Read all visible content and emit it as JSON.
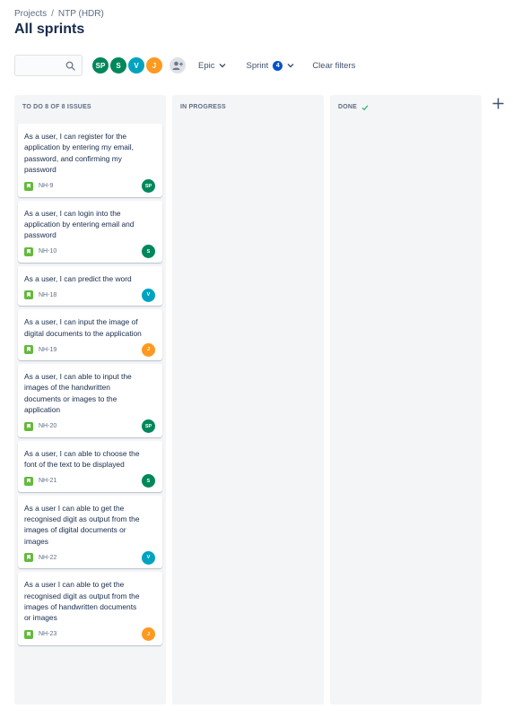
{
  "breadcrumb": {
    "root": "Projects",
    "separator": "/",
    "project": "NTP (HDR)"
  },
  "page_title": "All sprints",
  "toolbar": {
    "search_placeholder": "",
    "avatars": [
      {
        "initials": "SP",
        "color": "#00875a"
      },
      {
        "initials": "S",
        "color": "#00875a"
      },
      {
        "initials": "V",
        "color": "#00a3bf"
      },
      {
        "initials": "J",
        "color": "#ff991f"
      }
    ],
    "epic_label": "Epic",
    "sprint_label": "Sprint",
    "sprint_count": "4",
    "clear_filters_label": "Clear filters"
  },
  "columns": [
    {
      "title": "TO DO 8 OF 8 ISSUES"
    },
    {
      "title": "IN PROGRESS"
    },
    {
      "title": "DONE"
    }
  ],
  "cards": [
    {
      "title": "As a user, I can register for the application by entering my email, password, and confirming my password",
      "key": "NH-9",
      "assignee": "SP",
      "assignee_color": "#00875a"
    },
    {
      "title": "As a user, I can login into the application by entering email and password",
      "key": "NH-10",
      "assignee": "S",
      "assignee_color": "#00875a"
    },
    {
      "title": "As a user, I can predict the word",
      "key": "NH-18",
      "assignee": "V",
      "assignee_color": "#00a3bf"
    },
    {
      "title": "As a user, I can input the image of digital documents to the application",
      "key": "NH-19",
      "assignee": "J",
      "assignee_color": "#ff991f"
    },
    {
      "title": "As a user, I can able to input the images of the handwritten documents or images to the application",
      "key": "NH-20",
      "assignee": "SP",
      "assignee_color": "#00875a"
    },
    {
      "title": "As a user, I can able to choose the font of the text to be displayed",
      "key": "NH-21",
      "assignee": "S",
      "assignee_color": "#00875a"
    },
    {
      "title": "As a user I can able to get the recognised digit as output from the images of digital documents or images",
      "key": "NH-22",
      "assignee": "V",
      "assignee_color": "#00a3bf"
    },
    {
      "title": "As a user I can able to get the recognised digit as output from the images of handwritten documents or images",
      "key": "NH-23",
      "assignee": "J",
      "assignee_color": "#ff991f"
    }
  ],
  "icons": {
    "search": "search-icon",
    "add_people": "add-people-icon",
    "chevron": "chevron-down-icon",
    "done": "check-icon",
    "story": "story-icon",
    "add_column": "plus-icon"
  },
  "colors": {
    "accent": "#0052cc",
    "story": "#63ba3c",
    "column_bg": "#f4f5f7"
  }
}
